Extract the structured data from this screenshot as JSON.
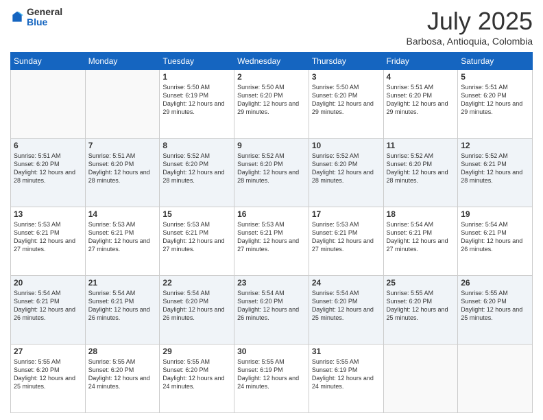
{
  "logo": {
    "general": "General",
    "blue": "Blue"
  },
  "header": {
    "month": "July 2025",
    "location": "Barbosa, Antioquia, Colombia"
  },
  "weekdays": [
    "Sunday",
    "Monday",
    "Tuesday",
    "Wednesday",
    "Thursday",
    "Friday",
    "Saturday"
  ],
  "weeks": [
    [
      {
        "day": "",
        "info": ""
      },
      {
        "day": "",
        "info": ""
      },
      {
        "day": "1",
        "info": "Sunrise: 5:50 AM\nSunset: 6:19 PM\nDaylight: 12 hours and 29 minutes."
      },
      {
        "day": "2",
        "info": "Sunrise: 5:50 AM\nSunset: 6:20 PM\nDaylight: 12 hours and 29 minutes."
      },
      {
        "day": "3",
        "info": "Sunrise: 5:50 AM\nSunset: 6:20 PM\nDaylight: 12 hours and 29 minutes."
      },
      {
        "day": "4",
        "info": "Sunrise: 5:51 AM\nSunset: 6:20 PM\nDaylight: 12 hours and 29 minutes."
      },
      {
        "day": "5",
        "info": "Sunrise: 5:51 AM\nSunset: 6:20 PM\nDaylight: 12 hours and 29 minutes."
      }
    ],
    [
      {
        "day": "6",
        "info": "Sunrise: 5:51 AM\nSunset: 6:20 PM\nDaylight: 12 hours and 28 minutes."
      },
      {
        "day": "7",
        "info": "Sunrise: 5:51 AM\nSunset: 6:20 PM\nDaylight: 12 hours and 28 minutes."
      },
      {
        "day": "8",
        "info": "Sunrise: 5:52 AM\nSunset: 6:20 PM\nDaylight: 12 hours and 28 minutes."
      },
      {
        "day": "9",
        "info": "Sunrise: 5:52 AM\nSunset: 6:20 PM\nDaylight: 12 hours and 28 minutes."
      },
      {
        "day": "10",
        "info": "Sunrise: 5:52 AM\nSunset: 6:20 PM\nDaylight: 12 hours and 28 minutes."
      },
      {
        "day": "11",
        "info": "Sunrise: 5:52 AM\nSunset: 6:20 PM\nDaylight: 12 hours and 28 minutes."
      },
      {
        "day": "12",
        "info": "Sunrise: 5:52 AM\nSunset: 6:21 PM\nDaylight: 12 hours and 28 minutes."
      }
    ],
    [
      {
        "day": "13",
        "info": "Sunrise: 5:53 AM\nSunset: 6:21 PM\nDaylight: 12 hours and 27 minutes."
      },
      {
        "day": "14",
        "info": "Sunrise: 5:53 AM\nSunset: 6:21 PM\nDaylight: 12 hours and 27 minutes."
      },
      {
        "day": "15",
        "info": "Sunrise: 5:53 AM\nSunset: 6:21 PM\nDaylight: 12 hours and 27 minutes."
      },
      {
        "day": "16",
        "info": "Sunrise: 5:53 AM\nSunset: 6:21 PM\nDaylight: 12 hours and 27 minutes."
      },
      {
        "day": "17",
        "info": "Sunrise: 5:53 AM\nSunset: 6:21 PM\nDaylight: 12 hours and 27 minutes."
      },
      {
        "day": "18",
        "info": "Sunrise: 5:54 AM\nSunset: 6:21 PM\nDaylight: 12 hours and 27 minutes."
      },
      {
        "day": "19",
        "info": "Sunrise: 5:54 AM\nSunset: 6:21 PM\nDaylight: 12 hours and 26 minutes."
      }
    ],
    [
      {
        "day": "20",
        "info": "Sunrise: 5:54 AM\nSunset: 6:21 PM\nDaylight: 12 hours and 26 minutes."
      },
      {
        "day": "21",
        "info": "Sunrise: 5:54 AM\nSunset: 6:21 PM\nDaylight: 12 hours and 26 minutes."
      },
      {
        "day": "22",
        "info": "Sunrise: 5:54 AM\nSunset: 6:20 PM\nDaylight: 12 hours and 26 minutes."
      },
      {
        "day": "23",
        "info": "Sunrise: 5:54 AM\nSunset: 6:20 PM\nDaylight: 12 hours and 26 minutes."
      },
      {
        "day": "24",
        "info": "Sunrise: 5:54 AM\nSunset: 6:20 PM\nDaylight: 12 hours and 25 minutes."
      },
      {
        "day": "25",
        "info": "Sunrise: 5:55 AM\nSunset: 6:20 PM\nDaylight: 12 hours and 25 minutes."
      },
      {
        "day": "26",
        "info": "Sunrise: 5:55 AM\nSunset: 6:20 PM\nDaylight: 12 hours and 25 minutes."
      }
    ],
    [
      {
        "day": "27",
        "info": "Sunrise: 5:55 AM\nSunset: 6:20 PM\nDaylight: 12 hours and 25 minutes."
      },
      {
        "day": "28",
        "info": "Sunrise: 5:55 AM\nSunset: 6:20 PM\nDaylight: 12 hours and 24 minutes."
      },
      {
        "day": "29",
        "info": "Sunrise: 5:55 AM\nSunset: 6:20 PM\nDaylight: 12 hours and 24 minutes."
      },
      {
        "day": "30",
        "info": "Sunrise: 5:55 AM\nSunset: 6:19 PM\nDaylight: 12 hours and 24 minutes."
      },
      {
        "day": "31",
        "info": "Sunrise: 5:55 AM\nSunset: 6:19 PM\nDaylight: 12 hours and 24 minutes."
      },
      {
        "day": "",
        "info": ""
      },
      {
        "day": "",
        "info": ""
      }
    ]
  ]
}
